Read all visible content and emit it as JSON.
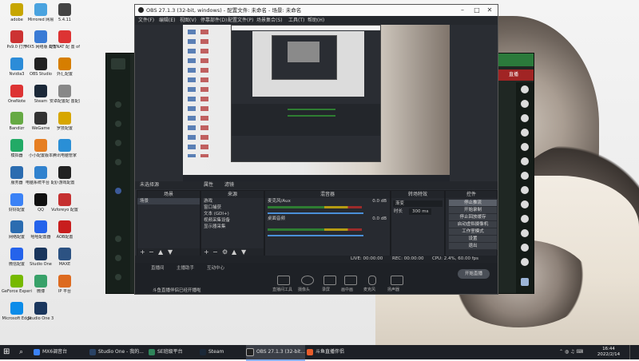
{
  "desktop_icons": [
    {
      "label": "adobe",
      "color": "#c7a600"
    },
    {
      "label": "Mirrored 网易",
      "color": "#4aa3df"
    },
    {
      "label": "5.4.11",
      "color": "#444"
    },
    {
      "label": "Ps9.0 打开",
      "color": "#c33"
    },
    {
      "label": "MX5 网络版 配置",
      "color": "#3a7bd5"
    },
    {
      "label": "DT/NAT 配 置 of bette...",
      "color": "#d33"
    },
    {
      "label": "Nvidia3",
      "color": "#2c8cd8"
    },
    {
      "label": "OBS Studio",
      "color": "#222"
    },
    {
      "label": "外汇配置",
      "color": "#d67e00"
    },
    {
      "label": "OneNote",
      "color": "#d33"
    },
    {
      "label": "Steam",
      "color": "#1b2838"
    },
    {
      "label": "安卓配置配 置配置-OW",
      "color": "#888"
    },
    {
      "label": "Bandizr",
      "color": "#6a4"
    },
    {
      "label": "WeGame",
      "color": "#333"
    },
    {
      "label": "罗技配置",
      "color": "#d7a600"
    },
    {
      "label": "模拟器",
      "color": "#2a6"
    },
    {
      "label": "小小配置版本",
      "color": "#e67e22"
    },
    {
      "label": "腾讯电脑管家",
      "color": "#2a8fd6"
    },
    {
      "label": "服务器",
      "color": "#2b6cb0"
    },
    {
      "label": "电脑系统平台 配置",
      "color": "#3182ce"
    },
    {
      "label": "小游戏配置",
      "color": "#222"
    },
    {
      "label": "好好配置",
      "color": "#3b82f6"
    },
    {
      "label": "QQ",
      "color": "#111"
    },
    {
      "label": "Vuforeyo 配置",
      "color": "#c53030"
    },
    {
      "label": "网络配置",
      "color": "#2b6cb0"
    },
    {
      "label": "哈哈配置器",
      "color": "#2563eb"
    },
    {
      "label": "AOB配置",
      "color": "#c81e1e"
    },
    {
      "label": "微信配置",
      "color": "#2563eb"
    },
    {
      "label": "Studio One",
      "color": "#1a365d"
    },
    {
      "label": "MAXE",
      "color": "#2c5282"
    },
    {
      "label": "GeForce Experience",
      "color": "#76b900"
    },
    {
      "label": "微博",
      "color": "#38a169"
    },
    {
      "label": "IP 平台",
      "color": "#dd6b20"
    },
    {
      "label": "Microsoft Edge",
      "color": "#0c8ce9"
    },
    {
      "label": "Studio One 3",
      "color": "#1a365d"
    }
  ],
  "obs": {
    "title": "OBS 27.1.3 (32-bit, windows) - 配置文件: 未命名 - 场景: 未命名",
    "menu": [
      "文件(F)",
      "编辑(E)",
      "视图(V)",
      "停靠部件(D)",
      "配置文件(P)",
      "场景集合(S)",
      "工具(T)",
      "帮助(H)"
    ],
    "source_name": "未选择源",
    "props_label": "属性",
    "filters_label": "滤镜",
    "docks": {
      "scenes": {
        "title": "场景",
        "items": [
          "场景"
        ]
      },
      "sources": {
        "title": "来源",
        "items": [
          "游戏",
          "窗口捕获",
          "文本 (GDI+)",
          "视频采集设备",
          "显示器采集"
        ]
      },
      "mixer": {
        "title": "混音器",
        "tracks": [
          {
            "name": "桌面音频",
            "db": "0.0 dB"
          },
          {
            "name": "麦克风/Aux",
            "db": "0.0 dB"
          }
        ]
      },
      "transitions": {
        "title": "转场特效",
        "type": "渐变",
        "duration_label": "时长",
        "duration": "300 ms"
      },
      "controls": {
        "title": "控件",
        "buttons": [
          "停止推流",
          "开始录制",
          "停止回放缓存",
          "启动虚拟摄像机",
          "工作室模式",
          "设置",
          "退出"
        ]
      }
    },
    "status": {
      "live": "LIVE: 00:00:00",
      "rec": "REC: 00:00:00",
      "cpu": "CPU: 2.4%, 60.00 fps"
    },
    "helper": {
      "tabs": [
        "直播间",
        "主播助手",
        "互动中心"
      ],
      "actions": [
        "直播间工具",
        "摄像头",
        "录屏",
        "画中画",
        "麦克风",
        "扬声器"
      ],
      "start_live": "开始直播",
      "notice": "斗鱼直播伴侣已经开播啦"
    }
  },
  "bgapp": {
    "badge": "直播"
  },
  "taskbar": {
    "items": [
      "MX6调音台",
      "Studio One - 我的...",
      "SE班级平台",
      "Steam",
      "OBS 27.1.3 (32-bit...",
      "斗鱼直播伴侣"
    ],
    "time": "16:44",
    "date": "2022/2/14"
  }
}
